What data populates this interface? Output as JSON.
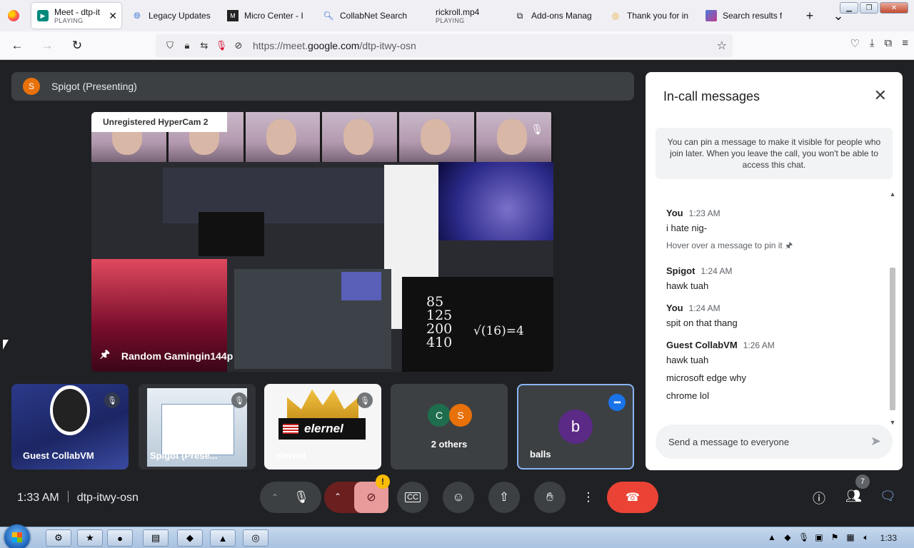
{
  "browser": {
    "tabs": [
      {
        "title": "Meet - dtp-it",
        "sub": "PLAYING",
        "icon": "meet-icon"
      },
      {
        "title": "Legacy Updates",
        "icon": "globe-icon"
      },
      {
        "title": "Micro Center - I",
        "icon": "microcenter-icon"
      },
      {
        "title": "CollabNet Search",
        "icon": "magnifier-icon"
      },
      {
        "title": "rickroll.mp4",
        "sub": "PLAYING",
        "icon": "video-icon"
      },
      {
        "title": "Add-ons Manag",
        "icon": "puzzle-icon"
      },
      {
        "title": "Thank you for in",
        "icon": "circle-icon"
      },
      {
        "title": "Search results f",
        "icon": "search-results-icon"
      }
    ],
    "new_tab": "+",
    "tab_list": "⌄",
    "url_prefix": "https://meet.",
    "url_domain": "google.com",
    "url_path": "/dtp-itwy-osn"
  },
  "meet": {
    "presenter": {
      "initial": "S",
      "label": "Spigot (Presenting)"
    },
    "main_video": {
      "watermark": "Unregistered HyperCam 2",
      "name": "Random Gamingin144p",
      "math_lines": [
        "85",
        "125",
        "200",
        "410"
      ],
      "math_sqrt": "√(16)=4"
    },
    "tiles": [
      {
        "name": "Guest CollabVM"
      },
      {
        "name": "Spigot (Prese..."
      },
      {
        "name": "elernel",
        "badge": "elernel"
      },
      {
        "name": "2 others",
        "initials": [
          "C",
          "S"
        ]
      },
      {
        "name": "balls",
        "initial": "b"
      }
    ],
    "meeting_time": "1:33 AM",
    "meeting_code": "dtp-itwy-osn",
    "people_count": "7"
  },
  "chat": {
    "title": "In-call messages",
    "pin_note": "You can pin a message to make it visible for people who join later. When you leave the call, you won't be able to access this chat.",
    "messages": [
      {
        "author": "You",
        "time": "1:23 AM",
        "lines": [
          "i hate nig-"
        ],
        "hint": "Hover over a message to pin it 🖈"
      },
      {
        "author": "Spigot",
        "time": "1:24 AM",
        "lines": [
          "hawk tuah"
        ]
      },
      {
        "author": "You",
        "time": "1:24 AM",
        "lines": [
          "spit on that thang"
        ]
      },
      {
        "author": "Guest CollabVM",
        "time": "1:26 AM",
        "lines": [
          "hawk tuah",
          "microsoft edge why",
          "chrome lol"
        ]
      }
    ],
    "input_placeholder": "Send a message to everyone"
  },
  "taskbar": {
    "time": "1:33"
  },
  "colors": {
    "meet_bg": "#202124",
    "end_call": "#ea4335",
    "accent_blue": "#1a73e8",
    "presenter_orange": "#e8710a"
  }
}
